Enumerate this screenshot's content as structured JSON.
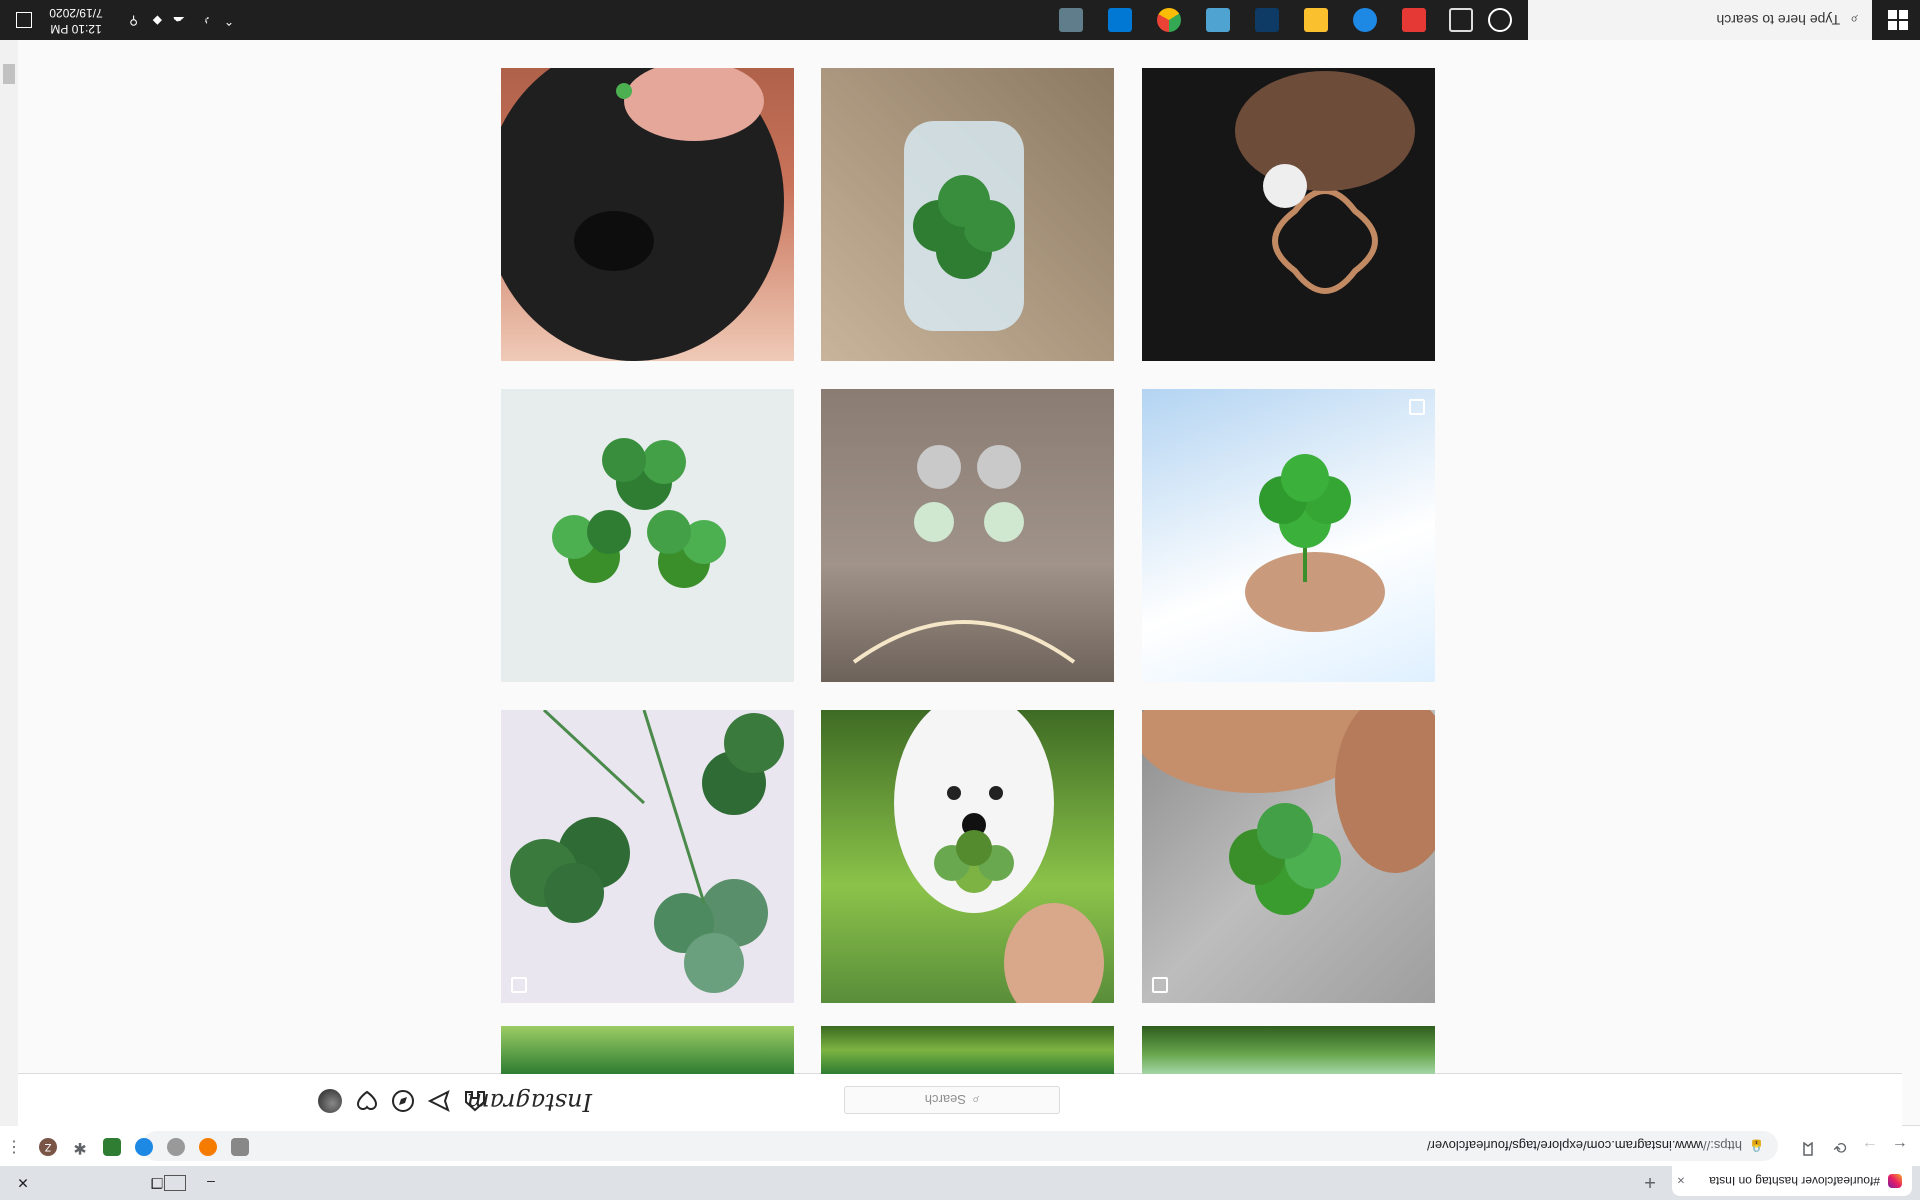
{
  "browser": {
    "tab_title": "#fourleafclover hashtag on Insta",
    "tab_close": "×",
    "new_tab": "+",
    "url_scheme": "https://",
    "url_rest": "www.instagram.com/explore/tags/fourleafclover/",
    "back": "←",
    "forward": "→",
    "reload": "⟳",
    "profile_initial": "Z",
    "menu": "⋮",
    "minimize": "–",
    "restore": "❐",
    "close": "✕"
  },
  "instagram": {
    "logo": "Instagram",
    "search_placeholder": "Search",
    "search_icon": "magnifier-icon"
  },
  "posts": [
    {
      "id": "row0-col0",
      "multi": false
    },
    {
      "id": "row0-col1",
      "multi": false
    },
    {
      "id": "row0-col2",
      "multi": false
    },
    {
      "id": "row1-col0",
      "multi": true
    },
    {
      "id": "row1-col1",
      "multi": false
    },
    {
      "id": "row1-col2",
      "multi": false
    },
    {
      "id": "row2-col0",
      "multi": false
    },
    {
      "id": "row2-col1",
      "multi": false
    },
    {
      "id": "row2-col2",
      "multi": true
    }
  ],
  "taskbar": {
    "search_placeholder": "Type here to search",
    "time": "12:10 PM",
    "date": "7/19/2020"
  },
  "colors": {
    "clover_green": "#3a8f2a",
    "chrome_bg": "#dee1e6",
    "taskbar_bg": "#1f1f1f"
  }
}
